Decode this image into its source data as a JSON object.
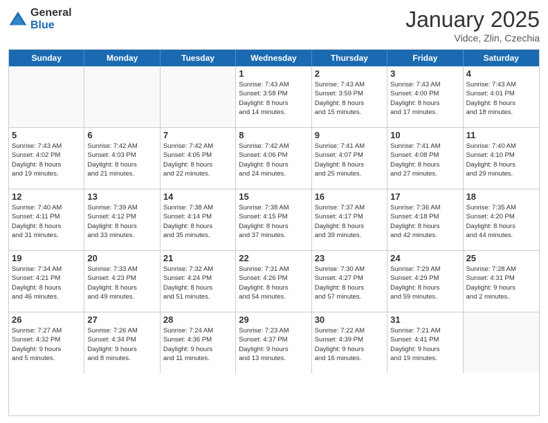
{
  "logo": {
    "general": "General",
    "blue": "Blue"
  },
  "header": {
    "month": "January 2025",
    "location": "Vidce, Zlin, Czechia"
  },
  "weekdays": [
    "Sunday",
    "Monday",
    "Tuesday",
    "Wednesday",
    "Thursday",
    "Friday",
    "Saturday"
  ],
  "weeks": [
    [
      {
        "day": "",
        "info": "",
        "empty": true
      },
      {
        "day": "",
        "info": "",
        "empty": true
      },
      {
        "day": "",
        "info": "",
        "empty": true
      },
      {
        "day": "1",
        "info": "Sunrise: 7:43 AM\nSunset: 3:58 PM\nDaylight: 8 hours\nand 14 minutes."
      },
      {
        "day": "2",
        "info": "Sunrise: 7:43 AM\nSunset: 3:59 PM\nDaylight: 8 hours\nand 15 minutes."
      },
      {
        "day": "3",
        "info": "Sunrise: 7:43 AM\nSunset: 4:00 PM\nDaylight: 8 hours\nand 17 minutes."
      },
      {
        "day": "4",
        "info": "Sunrise: 7:43 AM\nSunset: 4:01 PM\nDaylight: 8 hours\nand 18 minutes."
      }
    ],
    [
      {
        "day": "5",
        "info": "Sunrise: 7:43 AM\nSunset: 4:02 PM\nDaylight: 8 hours\nand 19 minutes."
      },
      {
        "day": "6",
        "info": "Sunrise: 7:42 AM\nSunset: 4:03 PM\nDaylight: 8 hours\nand 21 minutes."
      },
      {
        "day": "7",
        "info": "Sunrise: 7:42 AM\nSunset: 4:05 PM\nDaylight: 8 hours\nand 22 minutes."
      },
      {
        "day": "8",
        "info": "Sunrise: 7:42 AM\nSunset: 4:06 PM\nDaylight: 8 hours\nand 24 minutes."
      },
      {
        "day": "9",
        "info": "Sunrise: 7:41 AM\nSunset: 4:07 PM\nDaylight: 8 hours\nand 25 minutes."
      },
      {
        "day": "10",
        "info": "Sunrise: 7:41 AM\nSunset: 4:08 PM\nDaylight: 8 hours\nand 27 minutes."
      },
      {
        "day": "11",
        "info": "Sunrise: 7:40 AM\nSunset: 4:10 PM\nDaylight: 8 hours\nand 29 minutes."
      }
    ],
    [
      {
        "day": "12",
        "info": "Sunrise: 7:40 AM\nSunset: 4:11 PM\nDaylight: 8 hours\nand 31 minutes."
      },
      {
        "day": "13",
        "info": "Sunrise: 7:39 AM\nSunset: 4:12 PM\nDaylight: 8 hours\nand 33 minutes."
      },
      {
        "day": "14",
        "info": "Sunrise: 7:38 AM\nSunset: 4:14 PM\nDaylight: 8 hours\nand 35 minutes."
      },
      {
        "day": "15",
        "info": "Sunrise: 7:38 AM\nSunset: 4:15 PM\nDaylight: 8 hours\nand 37 minutes."
      },
      {
        "day": "16",
        "info": "Sunrise: 7:37 AM\nSunset: 4:17 PM\nDaylight: 8 hours\nand 39 minutes."
      },
      {
        "day": "17",
        "info": "Sunrise: 7:36 AM\nSunset: 4:18 PM\nDaylight: 8 hours\nand 42 minutes."
      },
      {
        "day": "18",
        "info": "Sunrise: 7:35 AM\nSunset: 4:20 PM\nDaylight: 8 hours\nand 44 minutes."
      }
    ],
    [
      {
        "day": "19",
        "info": "Sunrise: 7:34 AM\nSunset: 4:21 PM\nDaylight: 8 hours\nand 46 minutes."
      },
      {
        "day": "20",
        "info": "Sunrise: 7:33 AM\nSunset: 4:23 PM\nDaylight: 8 hours\nand 49 minutes."
      },
      {
        "day": "21",
        "info": "Sunrise: 7:32 AM\nSunset: 4:24 PM\nDaylight: 8 hours\nand 51 minutes."
      },
      {
        "day": "22",
        "info": "Sunrise: 7:31 AM\nSunset: 4:26 PM\nDaylight: 8 hours\nand 54 minutes."
      },
      {
        "day": "23",
        "info": "Sunrise: 7:30 AM\nSunset: 4:27 PM\nDaylight: 8 hours\nand 57 minutes."
      },
      {
        "day": "24",
        "info": "Sunrise: 7:29 AM\nSunset: 4:29 PM\nDaylight: 8 hours\nand 59 minutes."
      },
      {
        "day": "25",
        "info": "Sunrise: 7:28 AM\nSunset: 4:31 PM\nDaylight: 9 hours\nand 2 minutes."
      }
    ],
    [
      {
        "day": "26",
        "info": "Sunrise: 7:27 AM\nSunset: 4:32 PM\nDaylight: 9 hours\nand 5 minutes."
      },
      {
        "day": "27",
        "info": "Sunrise: 7:26 AM\nSunset: 4:34 PM\nDaylight: 9 hours\nand 8 minutes."
      },
      {
        "day": "28",
        "info": "Sunrise: 7:24 AM\nSunset: 4:36 PM\nDaylight: 9 hours\nand 11 minutes."
      },
      {
        "day": "29",
        "info": "Sunrise: 7:23 AM\nSunset: 4:37 PM\nDaylight: 9 hours\nand 13 minutes."
      },
      {
        "day": "30",
        "info": "Sunrise: 7:22 AM\nSunset: 4:39 PM\nDaylight: 9 hours\nand 16 minutes."
      },
      {
        "day": "31",
        "info": "Sunrise: 7:21 AM\nSunset: 4:41 PM\nDaylight: 9 hours\nand 19 minutes."
      },
      {
        "day": "",
        "info": "",
        "empty": true
      }
    ]
  ]
}
